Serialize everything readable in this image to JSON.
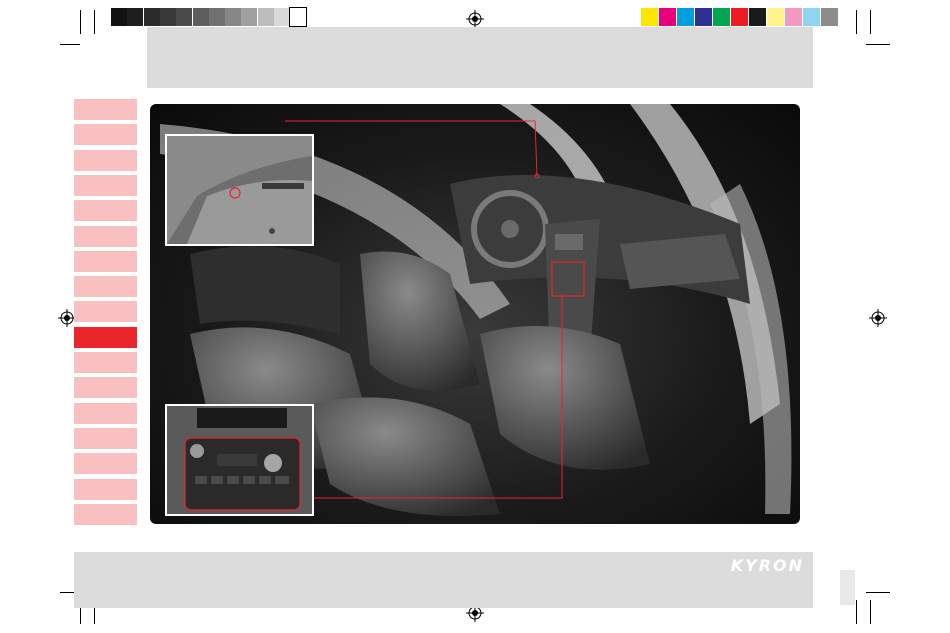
{
  "brand": {
    "logo_text": "KYRON"
  },
  "colors": {
    "accent_red": "#e8262c",
    "tab_pink": "#f9c0c2",
    "band_gray": "#dcdcdc",
    "callout_line": "#e8262c"
  },
  "color_bar_left": [
    "#111111",
    "#1e1e1e",
    "#2b2b2b",
    "#383838",
    "#4a4a4a",
    "#5d5d5d",
    "#717171",
    "#878787",
    "#a0a0a0",
    "#bdbdbd",
    "#dadada",
    "#ffffff"
  ],
  "color_bar_right": [
    "#ffe600",
    "#e6007e",
    "#00a0e0",
    "#2e3192",
    "#00a651",
    "#ed1c24",
    "#1a1a1a",
    "#fff38a",
    "#f49ac1",
    "#8fd4f2",
    "#8c8c8c"
  ],
  "side_tabs": {
    "count": 17,
    "active_index": 9
  },
  "icons": {
    "registration_mark": "registration-crosshair-icon"
  }
}
